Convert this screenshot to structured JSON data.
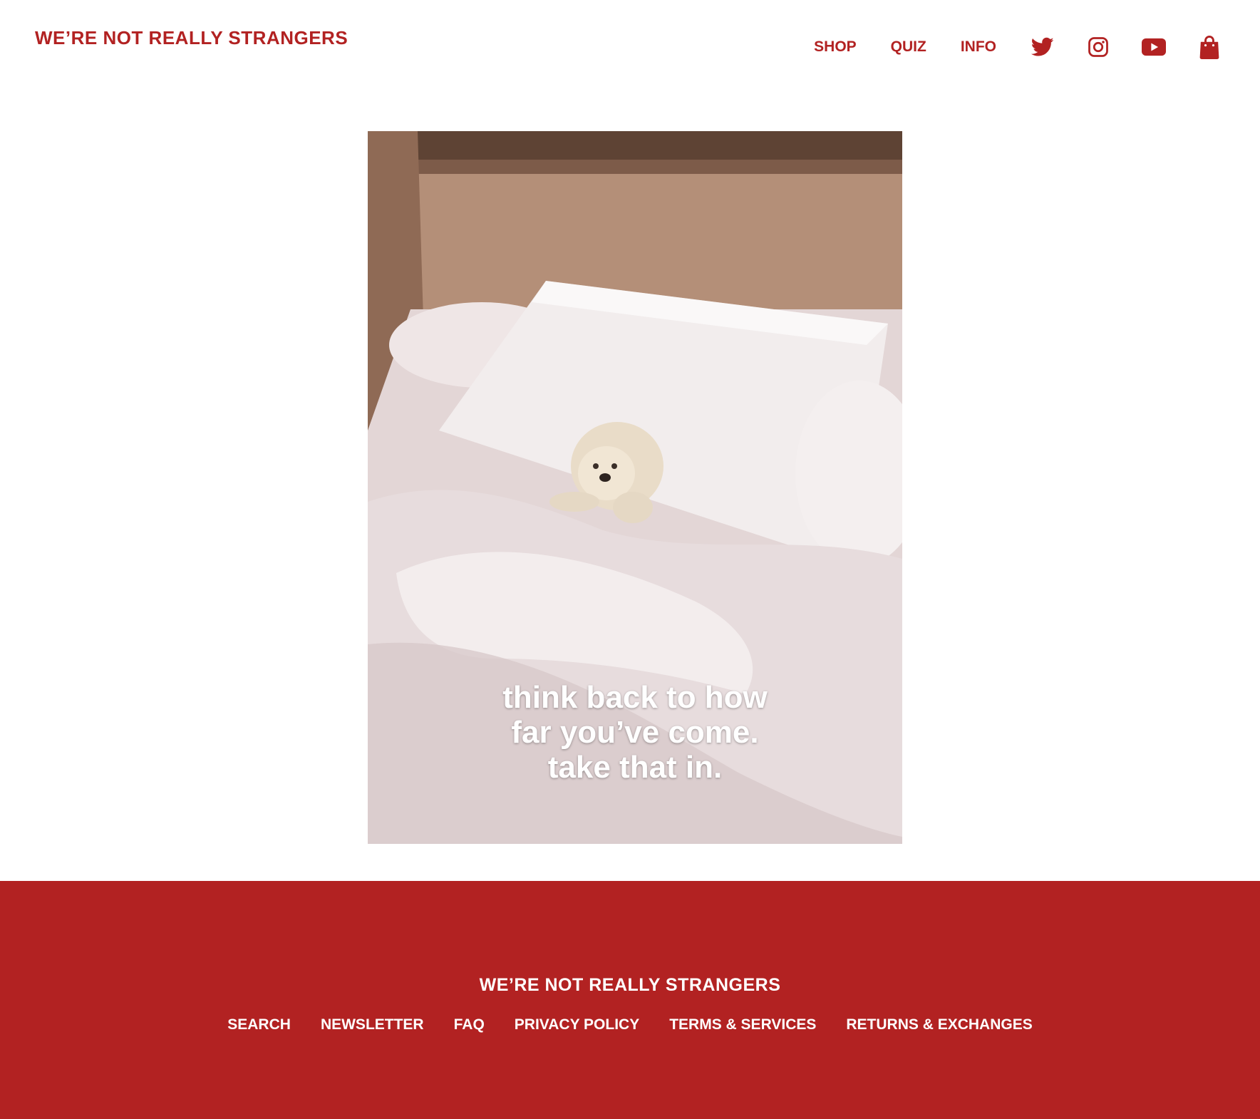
{
  "header": {
    "logo_text": "WE’RE NOT REALLY STRANGERS",
    "nav": [
      {
        "label": "SHOP"
      },
      {
        "label": "QUIZ"
      },
      {
        "label": "INFO"
      }
    ],
    "icons": [
      "twitter-icon",
      "instagram-icon",
      "youtube-icon",
      "shopping-bag-icon"
    ]
  },
  "hero": {
    "caption_lines": [
      "think back to how",
      "far you’ve come.",
      "take that in."
    ]
  },
  "footer": {
    "logo_text": "WE’RE NOT REALLY STRANGERS",
    "links": [
      {
        "label": "SEARCH"
      },
      {
        "label": "NEWSLETTER"
      },
      {
        "label": "FAQ"
      },
      {
        "label": "PRIVACY POLICY"
      },
      {
        "label": "TERMS & SERVICES"
      },
      {
        "label": "RETURNS & EXCHANGES"
      }
    ]
  },
  "colors": {
    "brand": "#b22222",
    "background": "#ffffff",
    "footer_text": "#ffffff"
  }
}
